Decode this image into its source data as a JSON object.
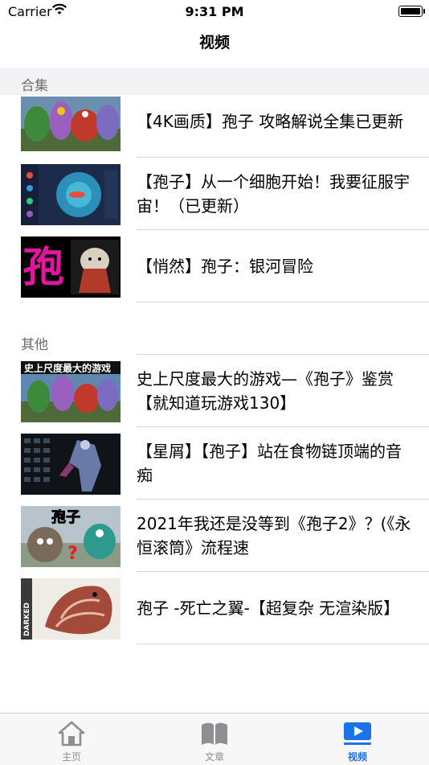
{
  "status_bar": {
    "carrier": "Carrier",
    "time": "9:31 PM"
  },
  "nav": {
    "title": "视频"
  },
  "sections": {
    "collections": {
      "header": "合集",
      "items": [
        {
          "title": "【4K画质】孢子 攻略解说全集已更新"
        },
        {
          "title": "【孢子】从一个细胞开始！我要征服宇宙！（已更新）"
        },
        {
          "title": "【悄然】孢子：银河冒险",
          "thumb_text": "孢"
        }
      ]
    },
    "others": {
      "header": "其他",
      "items": [
        {
          "title": "史上尺度最大的游戏—《孢子》鉴赏【就知道玩游戏130】",
          "thumb_text": "史上尺度最大的游戏"
        },
        {
          "title": "【星屑】【孢子】站在食物链顶端的音痴"
        },
        {
          "title": "2021年我还是没等到《孢子2》？(《永恒滚筒》流程速",
          "thumb_text": "孢子"
        },
        {
          "title": "孢子 -死亡之翼-【超复杂 无渲染版】",
          "thumb_text": "DARKED"
        }
      ]
    }
  },
  "tab_bar": {
    "tabs": [
      {
        "label": "主页",
        "icon": "house-icon"
      },
      {
        "label": "文章",
        "icon": "book-icon"
      },
      {
        "label": "视频",
        "icon": "video-icon",
        "active": true
      }
    ]
  },
  "colors": {
    "accent": "#1a73e8",
    "section_bg": "#f3f3f5",
    "separator": "#d6d6da"
  }
}
